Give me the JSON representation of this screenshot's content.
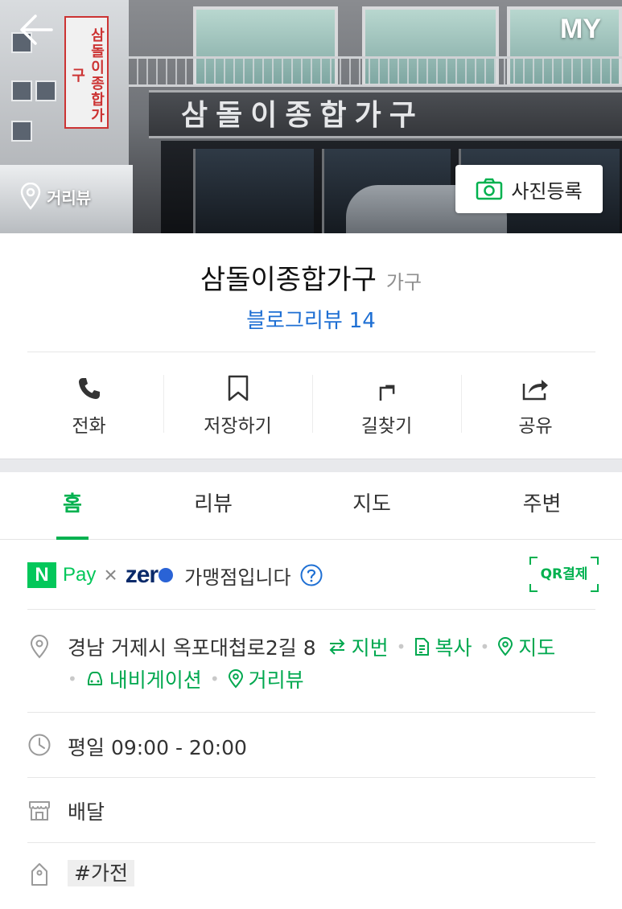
{
  "header": {
    "back_icon": "arrow-left-icon",
    "my_label": "MY",
    "street_view_label": "거리뷰",
    "photo_register_label": "사진등록"
  },
  "photo": {
    "signboard_text": "삼돌이종합가구",
    "vertical_sign_text": "삼돌이종합가구"
  },
  "place": {
    "name": "삼돌이종합가구",
    "category": "가구",
    "blog_review_label": "블로그리뷰",
    "blog_review_count": "14"
  },
  "actions": [
    {
      "label": "전화",
      "icon": "phone-icon"
    },
    {
      "label": "저장하기",
      "icon": "bookmark-icon"
    },
    {
      "label": "길찾기",
      "icon": "directions-icon"
    },
    {
      "label": "공유",
      "icon": "share-icon"
    }
  ],
  "tabs": [
    {
      "label": "홈",
      "active": true
    },
    {
      "label": "리뷰",
      "active": false
    },
    {
      "label": "지도",
      "active": false
    },
    {
      "label": "주변",
      "active": false
    }
  ],
  "pay": {
    "npay_badge": "N",
    "npay_text": "Pay",
    "times": "×",
    "zero_text": "zer",
    "merchant_text": "가맹점입니다",
    "qr_label": "QR결제"
  },
  "address": {
    "text": "경남 거제시 옥포대첩로2길 8",
    "lot_number_label": "지번",
    "copy_label": "복사",
    "map_label": "지도",
    "navigation_label": "내비게이션",
    "street_view_label": "거리뷰"
  },
  "hours": {
    "text": "평일 09:00 - 20:00"
  },
  "delivery": {
    "text": "배달"
  },
  "keyword": {
    "text": "#가전"
  },
  "colors": {
    "accent_green": "#00b14f",
    "npay_green": "#03c75a",
    "link_blue": "#1e6fd3"
  }
}
